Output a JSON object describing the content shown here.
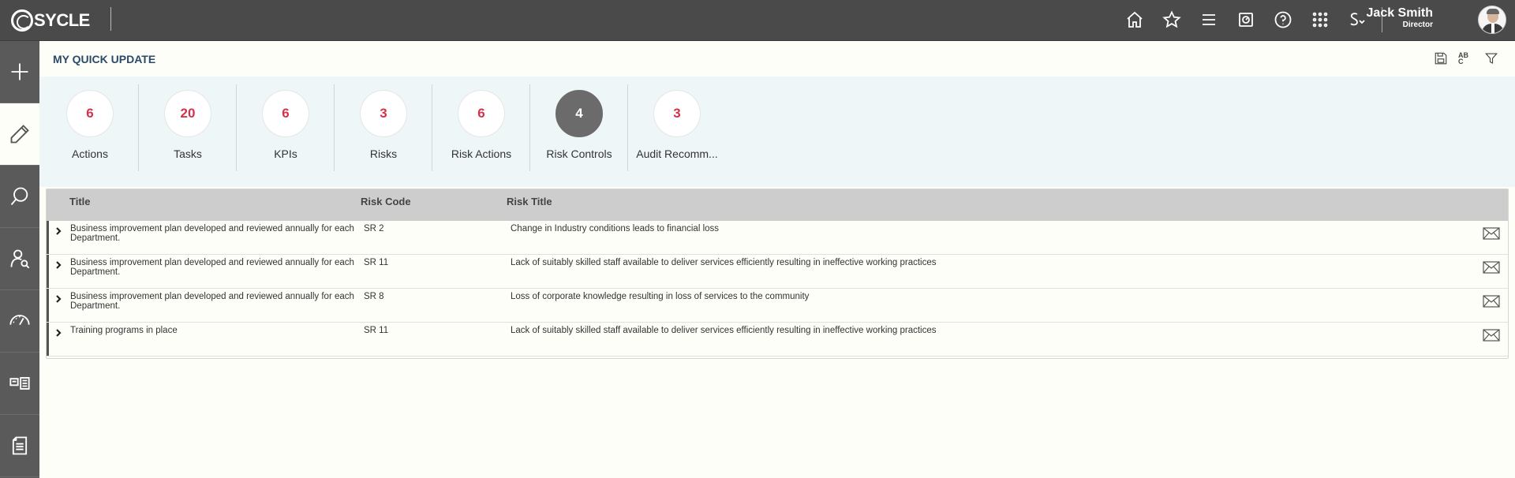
{
  "app": {
    "logo_text": "SYCLE"
  },
  "user": {
    "name": "Jack Smith",
    "role": "Director"
  },
  "page": {
    "title": "MY QUICK UPDATE"
  },
  "toolbar": {
    "spellcheck_label": "AB C"
  },
  "summary": [
    {
      "count": "6",
      "label": "Actions"
    },
    {
      "count": "20",
      "label": "Tasks"
    },
    {
      "count": "6",
      "label": "KPIs"
    },
    {
      "count": "3",
      "label": "Risks"
    },
    {
      "count": "6",
      "label": "Risk Actions"
    },
    {
      "count": "4",
      "label": "Risk Controls",
      "active": true
    },
    {
      "count": "3",
      "label": "Audit Recomm..."
    }
  ],
  "table": {
    "headers": {
      "title": "Title",
      "risk_code": "Risk Code",
      "risk_title": "Risk Title"
    },
    "rows": [
      {
        "title": "Business improvement plan developed and reviewed annually for each Department.",
        "risk_code": "SR 2",
        "risk_title": "Change in Industry conditions leads to financial loss"
      },
      {
        "title": "Business improvement plan developed and reviewed annually for each Department.",
        "risk_code": "SR 11",
        "risk_title": "Lack of suitably skilled staff available to deliver services efficiently resulting in ineffective working practices"
      },
      {
        "title": "Business improvement plan developed and reviewed annually for each Department.",
        "risk_code": "SR 8",
        "risk_title": "Loss of corporate knowledge resulting in loss of services to the community"
      },
      {
        "title": "Training programs in place",
        "risk_code": "SR 11",
        "risk_title": "Lack of suitably skilled staff available to deliver services efficiently resulting in ineffective working practices"
      }
    ]
  },
  "colors": {
    "topbar": "#4a4a4a",
    "sidebar": "#5a5a5a",
    "count_text": "#d2334c",
    "title": "#2b4a6a"
  }
}
